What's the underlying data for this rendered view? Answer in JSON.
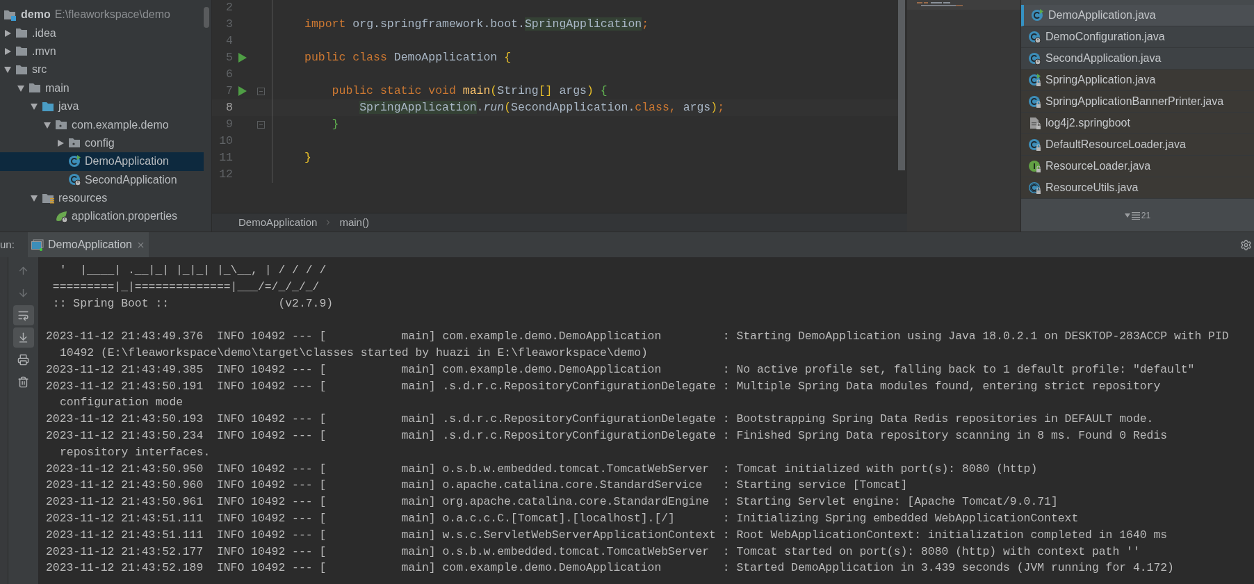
{
  "project": {
    "root": {
      "label": "demo",
      "path": "E:\\fleaworkspace\\demo"
    },
    "items": [
      {
        "label": ".idea",
        "kind": "folder",
        "expanded": false,
        "selected": false
      },
      {
        "label": ".mvn",
        "kind": "folder",
        "expanded": false,
        "selected": false
      },
      {
        "label": "src",
        "kind": "folder",
        "expanded": true,
        "selected": false,
        "children": [
          {
            "label": "main",
            "kind": "folder",
            "expanded": true,
            "selected": false,
            "children": [
              {
                "label": "java",
                "kind": "source-folder",
                "expanded": true,
                "selected": false,
                "children": [
                  {
                    "label": "com.example.demo",
                    "kind": "package",
                    "expanded": true,
                    "selected": false,
                    "children": [
                      {
                        "label": "config",
                        "kind": "package",
                        "expanded": false,
                        "selected": false
                      },
                      {
                        "label": "DemoApplication",
                        "kind": "class-run",
                        "selected": true
                      },
                      {
                        "label": "SecondApplication",
                        "kind": "class-spring",
                        "selected": false
                      }
                    ]
                  }
                ]
              },
              {
                "label": "resources",
                "kind": "resources-folder",
                "expanded": true,
                "selected": false,
                "children": [
                  {
                    "label": "application.properties",
                    "kind": "spring-properties",
                    "selected": false
                  }
                ]
              }
            ]
          }
        ]
      }
    ]
  },
  "editor": {
    "lines": [
      {
        "number": "2",
        "run": false,
        "fold": false,
        "current": false
      },
      {
        "number": "3",
        "run": false,
        "fold": false,
        "current": false,
        "tokens": [
          {
            "text": "import",
            "kind": "keyword"
          },
          {
            "text": " org.springframework.boot.",
            "kind": "plain"
          },
          {
            "text": "SpringApplication",
            "kind": "highlight"
          },
          {
            "text": ";",
            "kind": "keyword"
          }
        ]
      },
      {
        "number": "4",
        "run": false,
        "fold": false,
        "current": false
      },
      {
        "number": "5",
        "run": true,
        "fold": false,
        "current": false,
        "tokens": [
          {
            "text": "public class",
            "kind": "keyword"
          },
          {
            "text": " DemoApplication ",
            "kind": "plain"
          },
          {
            "text": "{",
            "kind": "yellow"
          }
        ]
      },
      {
        "number": "6",
        "run": false,
        "fold": false,
        "current": false
      },
      {
        "number": "7",
        "run": true,
        "fold": true,
        "current": false,
        "tokens": [
          {
            "text": "    public static void ",
            "kind": "keyword"
          },
          {
            "text": "main",
            "kind": "method"
          },
          {
            "text": "(",
            "kind": "yellow"
          },
          {
            "text": "String",
            "kind": "plain"
          },
          {
            "text": "[]",
            "kind": "yellow"
          },
          {
            "text": " args",
            "kind": "plain"
          },
          {
            "text": ") ",
            "kind": "yellow"
          },
          {
            "text": "{",
            "kind": "green"
          }
        ]
      },
      {
        "number": "8",
        "run": false,
        "fold": false,
        "current": true,
        "tokens": [
          {
            "text": "        SpringApplication",
            "kind": "highlight"
          },
          {
            "text": ".",
            "kind": "plain"
          },
          {
            "text": "run",
            "kind": "static"
          },
          {
            "text": "(",
            "kind": "yellow"
          },
          {
            "text": "SecondApplication.",
            "kind": "plain"
          },
          {
            "text": "class",
            "kind": "keyword"
          },
          {
            "text": ",",
            "kind": "keyword"
          },
          {
            "text": " args",
            "kind": "plain"
          },
          {
            "text": ")",
            "kind": "yellow"
          },
          {
            "text": ";",
            "kind": "keyword"
          }
        ]
      },
      {
        "number": "9",
        "run": false,
        "fold": true,
        "current": false,
        "tokens": [
          {
            "text": "    }",
            "kind": "green"
          }
        ]
      },
      {
        "number": "10",
        "run": false,
        "fold": false,
        "current": false
      },
      {
        "number": "11",
        "run": false,
        "fold": false,
        "current": false,
        "tokens": [
          {
            "text": "}",
            "kind": "yellow"
          }
        ]
      },
      {
        "number": "12",
        "run": false,
        "fold": false,
        "current": false
      }
    ],
    "breadcrumbs": [
      "DemoApplication",
      "main()"
    ]
  },
  "popup": {
    "items": [
      {
        "label": "DemoApplication.java",
        "kind": "class-run",
        "library": false,
        "selected": true
      },
      {
        "label": "DemoConfiguration.java",
        "kind": "class-spring",
        "library": false,
        "selected": false
      },
      {
        "label": "SecondApplication.java",
        "kind": "class-spring",
        "library": false,
        "selected": false
      },
      {
        "label": "SpringApplication.java",
        "kind": "class-run",
        "library": true,
        "selected": false
      },
      {
        "label": "SpringApplicationBannerPrinter.java",
        "kind": "class",
        "library": true,
        "selected": false
      },
      {
        "label": "log4j2.springboot",
        "kind": "file",
        "library": true,
        "selected": false
      },
      {
        "label": "DefaultResourceLoader.java",
        "kind": "class",
        "library": true,
        "selected": false
      },
      {
        "label": "ResourceLoader.java",
        "kind": "interface",
        "library": true,
        "selected": false
      },
      {
        "label": "ResourceUtils.java",
        "kind": "abstract-class",
        "library": true,
        "selected": false
      }
    ],
    "count": "21"
  },
  "run": {
    "label": "un:",
    "tabs": [
      {
        "label": "DemoApplication",
        "selected": true
      }
    ]
  },
  "console": {
    "tools": [
      {
        "kind": "up",
        "toggled": false
      },
      {
        "kind": "down",
        "toggled": false
      },
      {
        "kind": "wrap",
        "toggled": true
      },
      {
        "kind": "scroll-end",
        "toggled": true
      },
      {
        "kind": "print",
        "toggled": false
      },
      {
        "kind": "clear",
        "toggled": false
      }
    ],
    "banner": [
      "  '  |____| .__|_| |_|_| |_\\__, | / / / /",
      " =========|_|==============|___/=/_/_/_/",
      " :: Spring Boot ::                (v2.7.9)"
    ],
    "log": [
      {
        "lines": [
          "2023-11-12 21:43:49.376  INFO 10492 --- [           main] com.example.demo.DemoApplication         : Starting DemoApplication using Java 18.0.2.1 on DESKTOP-283ACCP with PID",
          "10492 (E:\\fleaworkspace\\demo\\target\\classes started by huazi in E:\\fleaworkspace\\demo)"
        ]
      },
      {
        "lines": [
          "2023-11-12 21:43:49.385  INFO 10492 --- [           main] com.example.demo.DemoApplication         : No active profile set, falling back to 1 default profile: \"default\""
        ]
      },
      {
        "lines": [
          "2023-11-12 21:43:50.191  INFO 10492 --- [           main] .s.d.r.c.RepositoryConfigurationDelegate : Multiple Spring Data modules found, entering strict repository",
          "configuration mode"
        ]
      },
      {
        "lines": [
          "2023-11-12 21:43:50.193  INFO 10492 --- [           main] .s.d.r.c.RepositoryConfigurationDelegate : Bootstrapping Spring Data Redis repositories in DEFAULT mode."
        ]
      },
      {
        "lines": [
          "2023-11-12 21:43:50.234  INFO 10492 --- [           main] .s.d.r.c.RepositoryConfigurationDelegate : Finished Spring Data repository scanning in 8 ms. Found 0 Redis",
          "repository interfaces."
        ]
      },
      {
        "lines": [
          "2023-11-12 21:43:50.950  INFO 10492 --- [           main] o.s.b.w.embedded.tomcat.TomcatWebServer  : Tomcat initialized with port(s): 8080 (http)"
        ]
      },
      {
        "lines": [
          "2023-11-12 21:43:50.960  INFO 10492 --- [           main] o.apache.catalina.core.StandardService   : Starting service [Tomcat]"
        ]
      },
      {
        "lines": [
          "2023-11-12 21:43:50.961  INFO 10492 --- [           main] org.apache.catalina.core.StandardEngine  : Starting Servlet engine: [Apache Tomcat/9.0.71]"
        ]
      },
      {
        "lines": [
          "2023-11-12 21:43:51.111  INFO 10492 --- [           main] o.a.c.c.C.[Tomcat].[localhost].[/]       : Initializing Spring embedded WebApplicationContext"
        ]
      },
      {
        "lines": [
          "2023-11-12 21:43:51.111  INFO 10492 --- [           main] w.s.c.ServletWebServerApplicationContext : Root WebApplicationContext: initialization completed in 1640 ms"
        ]
      },
      {
        "lines": [
          "2023-11-12 21:43:52.177  INFO 10492 --- [           main] o.s.b.w.embedded.tomcat.TomcatWebServer  : Tomcat started on port(s): 8080 (http) with context path ''"
        ]
      },
      {
        "lines": [
          "2023-11-12 21:43:52.189  INFO 10492 --- [           main] com.example.demo.DemoApplication         : Started DemoApplication in 3.439 seconds (JVM running for 4.172)"
        ]
      }
    ]
  }
}
